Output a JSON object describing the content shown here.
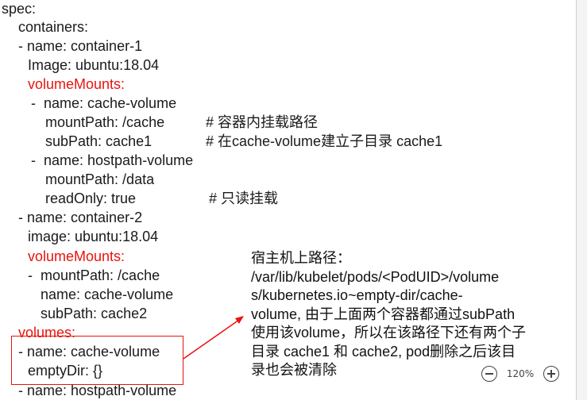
{
  "yaml_lines": [
    "spec:",
    "containers:",
    "- name: container-1",
    "Image: ubuntu:18.04",
    "volumeMounts:",
    "-  name: cache-volume",
    "mountPath: /cache",
    "subPath: cache1",
    "-  name: hostpath-volume",
    "mountPath: /data",
    "readOnly: true",
    "- name: container-2",
    "image: ubuntu:18.04",
    "volumeMounts:",
    "-  mountPath: /cache",
    "name: cache-volume",
    "subPath: cache2",
    "volumes:",
    "- name: cache-volume",
    "emptyDir: {}",
    "- name: hostpath-volume"
  ],
  "comments": {
    "mountpath_comment": "# 容器内挂载路径",
    "subpath_comment": "# 在cache-volume建立子目录 cache1",
    "readonly_comment": "# 只读挂载"
  },
  "note_lines": [
    "宿主机上路径：",
    "/var/lib/kubelet/pods/<PodUID>/volume",
    "s/kubernetes.io~empty-dir/cache-",
    "volume, 由于上面两个容器都通过subPath",
    "使用该volume，所以在该路径下还有两个子",
    "目录 cache1 和 cache2, pod删除之后该目",
    "录也会被清除"
  ],
  "zoom": {
    "level": "120%",
    "zoom_out_icon": "minus-circle-icon",
    "zoom_in_icon": "plus-circle-icon"
  },
  "colors": {
    "highlight": "#e8140f",
    "text": "#1a1a1a"
  }
}
